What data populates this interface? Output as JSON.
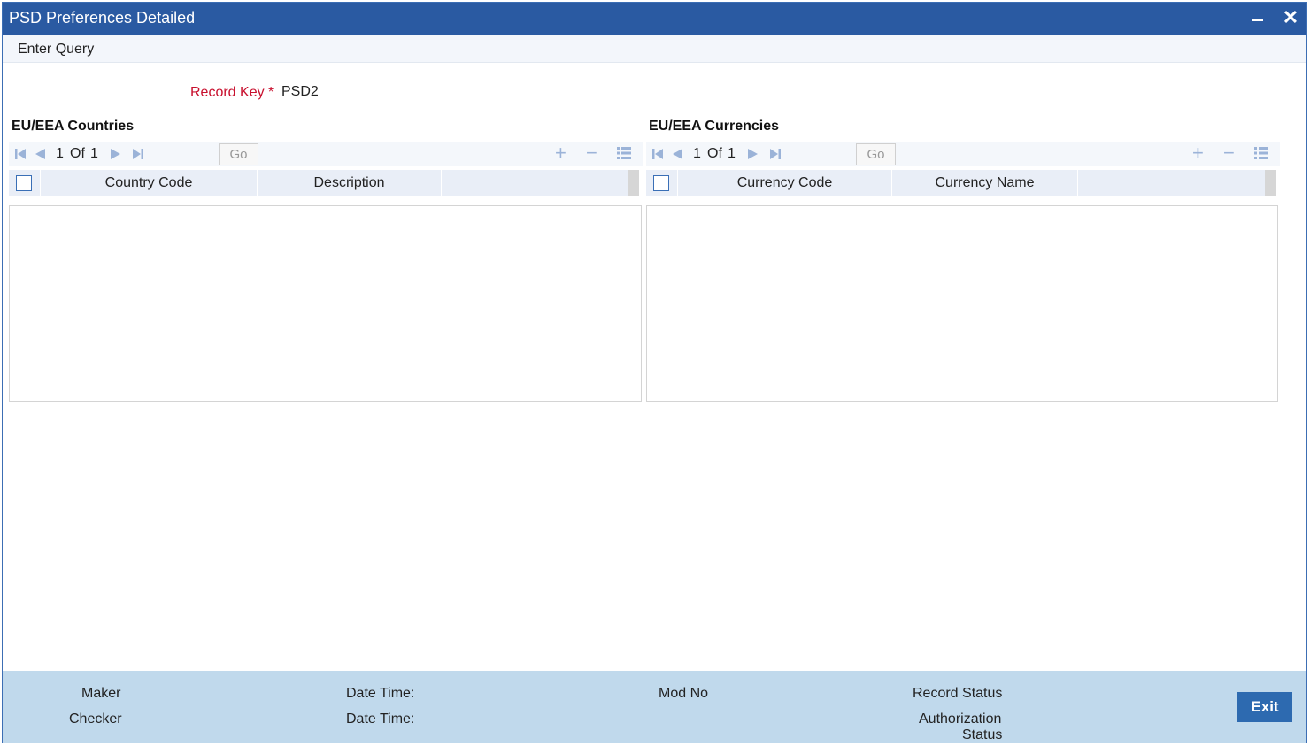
{
  "window": {
    "title": "PSD Preferences Detailed",
    "close_glyph": "✕"
  },
  "menu": {
    "enter_query": "Enter Query"
  },
  "record_key": {
    "label": "Record Key",
    "required_mark": "*",
    "value": "PSD2"
  },
  "countries": {
    "title": "EU/EEA Countries",
    "page_current": "1",
    "page_of": "Of",
    "page_total": "1",
    "go_label": "Go",
    "columns": [
      "Country Code",
      "Description"
    ]
  },
  "currencies": {
    "title": "EU/EEA Currencies",
    "page_current": "1",
    "page_of": "Of",
    "page_total": "1",
    "go_label": "Go",
    "columns": [
      "Currency Code",
      "Currency Name"
    ]
  },
  "footer": {
    "maker": "Maker",
    "checker": "Checker",
    "date_time_1": "Date Time:",
    "date_time_2": "Date Time:",
    "mod_no": "Mod No",
    "record_status": "Record Status",
    "authorization_status_1": "Authorization",
    "authorization_status_2": "Status",
    "exit": "Exit"
  },
  "icons": {
    "first": "first-page-icon",
    "prev": "prev-page-icon",
    "next": "next-page-icon",
    "last": "last-page-icon",
    "add": "add-row-icon",
    "delete": "delete-row-icon",
    "view": "view-list-icon"
  },
  "colors": {
    "titlebar": "#2a5aa2",
    "required": "#c8102e",
    "footer": "#c0d9ec",
    "exit_button": "#2d6ab0"
  }
}
